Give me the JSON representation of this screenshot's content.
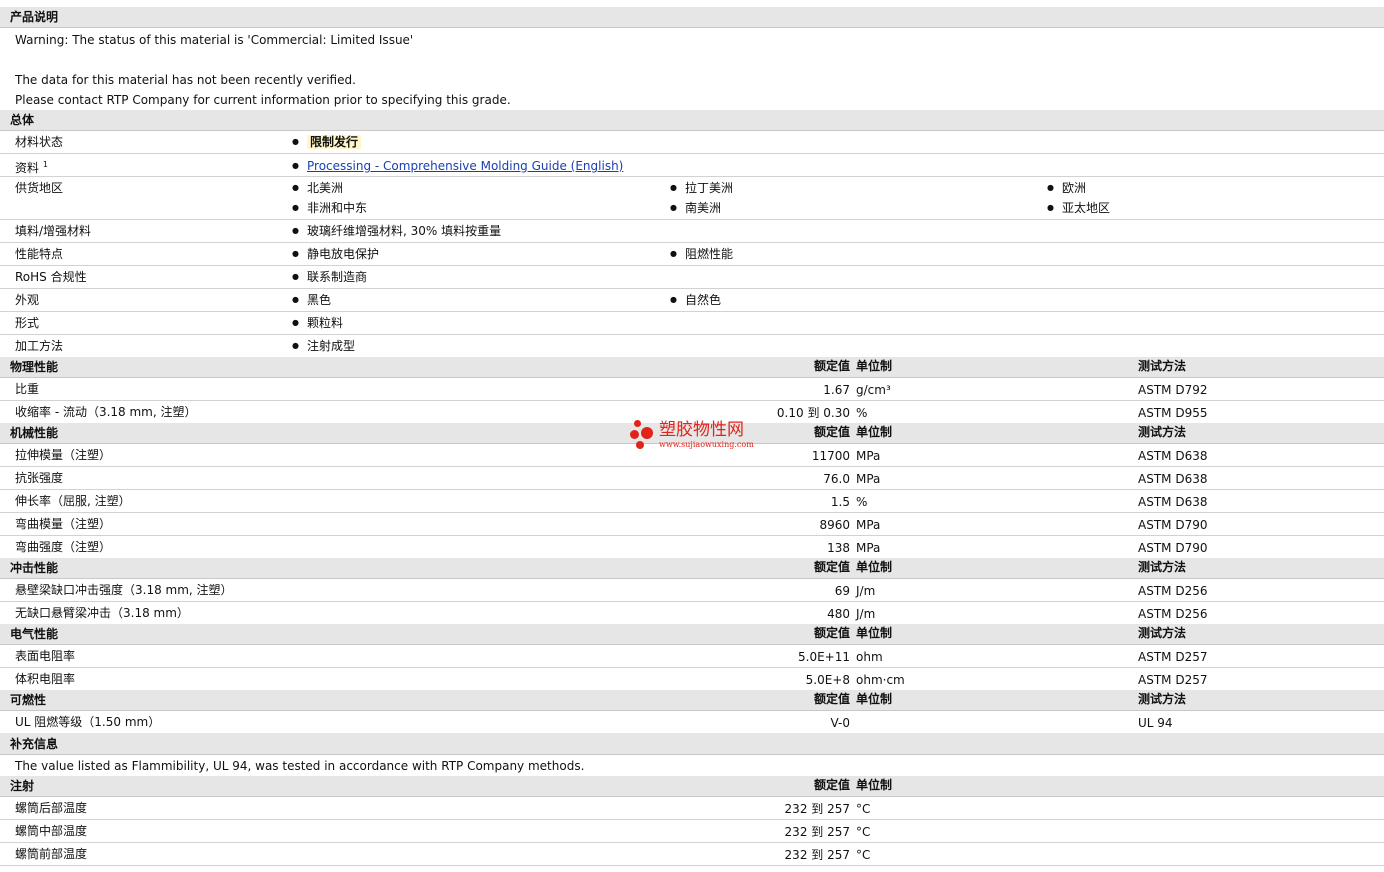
{
  "product_desc": {
    "title": "产品说明",
    "warning": "Warning: The status of this material is 'Commercial: Limited Issue'",
    "line2": "The data for this material has not been recently verified.",
    "line3": "Please contact RTP Company for current information prior to specifying this grade."
  },
  "general": {
    "title": "总体",
    "status_label": "材料状态",
    "status_value": "限制发行",
    "docs_label": "资料",
    "docs_sup": "1",
    "docs_link": "Processing - Comprehensive Molding Guide (English)",
    "region_label": "供货地区",
    "regions": [
      "北美洲",
      "拉丁美洲",
      "欧洲",
      "非洲和中东",
      "南美洲",
      "亚太地区"
    ],
    "filler_label": "填料/增强材料",
    "filler_value": "玻璃纤维增强材料, 30% 填料按重量",
    "features_label": "性能特点",
    "features": [
      "静电放电保护",
      "阻燃性能"
    ],
    "rohs_label": "RoHS 合规性",
    "rohs_value": "联系制造商",
    "appearance_label": "外观",
    "appearance": [
      "黑色",
      "自然色"
    ],
    "form_label": "形式",
    "form_value": "颗粒料",
    "process_label": "加工方法",
    "process_value": "注射成型"
  },
  "headers": {
    "nominal": "额定值",
    "unit": "单位制",
    "method": "测试方法"
  },
  "physical": {
    "title": "物理性能",
    "rows": [
      {
        "name": "比重",
        "value": "1.67",
        "unit": "g/cm³",
        "method": "ASTM D792"
      },
      {
        "name": "收缩率 - 流动（3.18 mm, 注塑）",
        "value": "0.10 到  0.30",
        "unit": "%",
        "method": "ASTM D955"
      }
    ]
  },
  "mechanical": {
    "title": "机械性能",
    "rows": [
      {
        "name": "拉伸模量（注塑）",
        "value": "11700",
        "unit": "MPa",
        "method": "ASTM D638"
      },
      {
        "name": "抗张强度",
        "value": "76.0",
        "unit": "MPa",
        "method": "ASTM D638"
      },
      {
        "name": "伸长率（屈服, 注塑）",
        "value": "1.5",
        "unit": "%",
        "method": "ASTM D638"
      },
      {
        "name": "弯曲模量（注塑）",
        "value": "8960",
        "unit": "MPa",
        "method": "ASTM D790"
      },
      {
        "name": "弯曲强度（注塑）",
        "value": "138",
        "unit": "MPa",
        "method": "ASTM D790"
      }
    ]
  },
  "impact": {
    "title": "冲击性能",
    "rows": [
      {
        "name": "悬壁梁缺口冲击强度（3.18 mm, 注塑）",
        "value": "69",
        "unit": "J/m",
        "method": "ASTM D256"
      },
      {
        "name": "无缺口悬臂梁冲击（3.18 mm）",
        "value": "480",
        "unit": "J/m",
        "method": "ASTM D256"
      }
    ]
  },
  "electrical": {
    "title": "电气性能",
    "rows": [
      {
        "name": "表面电阻率",
        "value": "5.0E+11",
        "unit": "ohm",
        "method": "ASTM D257"
      },
      {
        "name": "体积电阻率",
        "value": "5.0E+8",
        "unit": "ohm·cm",
        "method": "ASTM D257"
      }
    ]
  },
  "flammability": {
    "title": "可燃性",
    "rows": [
      {
        "name": "UL 阻燃等级（1.50 mm）",
        "value": "V-0",
        "unit": "",
        "method": "UL 94"
      }
    ]
  },
  "supplement": {
    "title": "补充信息",
    "text": "The value listed as Flammibility, UL 94, was tested in accordance with RTP Company methods."
  },
  "injection": {
    "title": "注射",
    "rows": [
      {
        "name": "螺筒后部温度",
        "value": "232 到  257",
        "unit": "°C"
      },
      {
        "name": "螺筒中部温度",
        "value": "232 到  257",
        "unit": "°C"
      },
      {
        "name": "螺筒前部温度",
        "value": "232 到  257",
        "unit": "°C"
      }
    ]
  },
  "watermark": {
    "name": "塑胶物性网",
    "url": "www.sujiaowuxing.com",
    "color": "#e2231a"
  }
}
